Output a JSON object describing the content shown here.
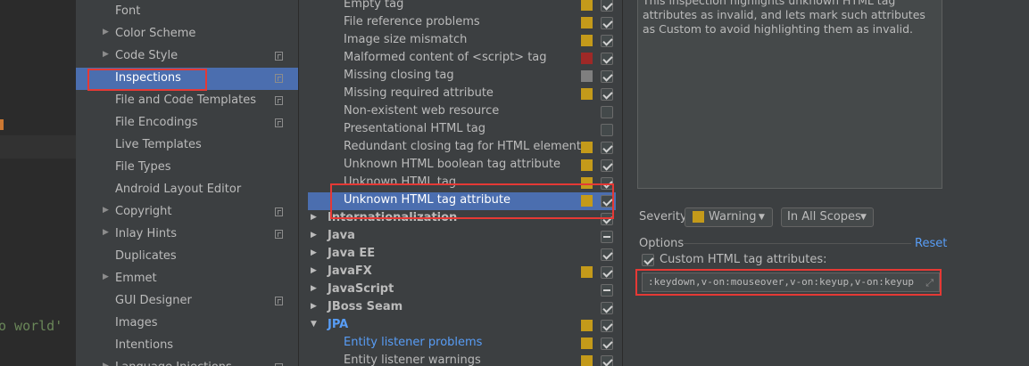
{
  "editor": {
    "code_fragment": "o world'",
    "code_color": "#6a8759",
    "marker_color": "#cc7832"
  },
  "tree": {
    "selected_color": "#4b6eaf",
    "items": [
      {
        "label": "Font",
        "expandable": false,
        "project_icon": false
      },
      {
        "label": "Color Scheme",
        "expandable": true,
        "project_icon": false
      },
      {
        "label": "Code Style",
        "expandable": true,
        "project_icon": true
      },
      {
        "label": "Inspections",
        "expandable": false,
        "project_icon": true,
        "selected": true
      },
      {
        "label": "File and Code Templates",
        "expandable": false,
        "project_icon": true
      },
      {
        "label": "File Encodings",
        "expandable": false,
        "project_icon": true
      },
      {
        "label": "Live Templates",
        "expandable": false,
        "project_icon": false
      },
      {
        "label": "File Types",
        "expandable": false,
        "project_icon": false
      },
      {
        "label": "Android Layout Editor",
        "expandable": false,
        "project_icon": false
      },
      {
        "label": "Copyright",
        "expandable": true,
        "project_icon": true
      },
      {
        "label": "Inlay Hints",
        "expandable": true,
        "project_icon": true
      },
      {
        "label": "Duplicates",
        "expandable": false,
        "project_icon": false
      },
      {
        "label": "Emmet",
        "expandable": true,
        "project_icon": false
      },
      {
        "label": "GUI Designer",
        "expandable": false,
        "project_icon": true
      },
      {
        "label": "Images",
        "expandable": false,
        "project_icon": false
      },
      {
        "label": "Intentions",
        "expandable": false,
        "project_icon": false
      },
      {
        "label": "Language Injections",
        "expandable": true,
        "project_icon": true
      }
    ]
  },
  "severity_colors": {
    "warning": "#c49a1a",
    "error": "#9e2927",
    "weak": "#7f7f7f"
  },
  "inspections": {
    "rows": [
      {
        "label": "Empty tag",
        "kind": "child",
        "severity": "warning",
        "check": "on"
      },
      {
        "label": "File reference problems",
        "kind": "child",
        "severity": "warning",
        "check": "on"
      },
      {
        "label": "Image size mismatch",
        "kind": "child",
        "severity": "warning",
        "check": "on"
      },
      {
        "label": "Malformed content of <script> tag",
        "kind": "child",
        "severity": "error",
        "check": "on"
      },
      {
        "label": "Missing closing tag",
        "kind": "child",
        "severity": "weak",
        "check": "on"
      },
      {
        "label": "Missing required attribute",
        "kind": "child",
        "severity": "warning",
        "check": "on"
      },
      {
        "label": "Non-existent web resource",
        "kind": "child",
        "severity": "",
        "check": "off"
      },
      {
        "label": "Presentational HTML tag",
        "kind": "child",
        "severity": "",
        "check": "off"
      },
      {
        "label": "Redundant closing tag for HTML element",
        "kind": "child",
        "severity": "warning",
        "check": "on"
      },
      {
        "label": "Unknown HTML boolean tag attribute",
        "kind": "child",
        "severity": "warning",
        "check": "on"
      },
      {
        "label": "Unknown HTML tag",
        "kind": "child",
        "severity": "warning",
        "check": "on"
      },
      {
        "label": "Unknown HTML tag attribute",
        "kind": "child",
        "severity": "warning",
        "check": "on",
        "selected": true
      },
      {
        "label": "Internationalization",
        "kind": "group",
        "severity": "",
        "check": "on"
      },
      {
        "label": "Java",
        "kind": "group",
        "severity": "",
        "check": "mixed"
      },
      {
        "label": "Java EE",
        "kind": "group",
        "severity": "",
        "check": "on"
      },
      {
        "label": "JavaFX",
        "kind": "group",
        "severity": "warning",
        "check": "on"
      },
      {
        "label": "JavaScript",
        "kind": "group",
        "severity": "",
        "check": "mixed"
      },
      {
        "label": "JBoss Seam",
        "kind": "group",
        "severity": "",
        "check": "on"
      },
      {
        "label": "JPA",
        "kind": "group",
        "severity": "warning",
        "check": "on",
        "expanded": true,
        "blue": true
      },
      {
        "label": "Entity listener problems",
        "kind": "child",
        "severity": "warning",
        "check": "on",
        "blue": true
      },
      {
        "label": "Entity listener warnings",
        "kind": "child",
        "severity": "warning",
        "check": "on"
      }
    ]
  },
  "detail": {
    "description": "This inspection highlights unknown HTML tag attributes as invalid, and lets mark such attributes as Custom to avoid highlighting them as invalid.",
    "severity_label": "Severity:",
    "severity_value": "Warning",
    "scope_value": "In All Scopes",
    "options_label": "Options",
    "reset_label": "Reset",
    "custom_label": "Custom HTML tag attributes:",
    "custom_value": ":keydown,v-on:mouseover,v-on:keyup,v-on:keyup.enter",
    "link_color": "#589df6"
  },
  "annotation_color": "#e53935"
}
